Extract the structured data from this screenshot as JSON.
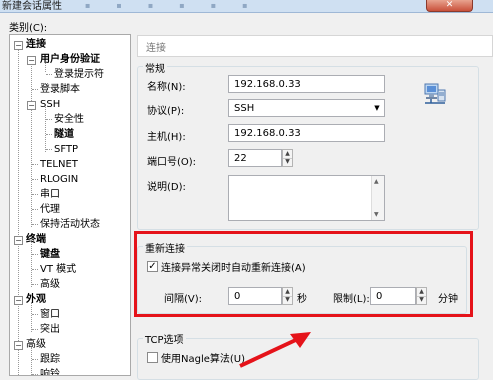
{
  "window": {
    "title": "新建会话属性",
    "close_glyph": "✕"
  },
  "category_label": "类别(C):",
  "tree": {
    "connection": "连接",
    "user_auth": "用户身份验证",
    "login_prompt": "登录提示符",
    "login_script": "登录脚本",
    "ssh": "SSH",
    "security": "安全性",
    "tunnel": "隧道",
    "sftp": "SFTP",
    "telnet": "TELNET",
    "rlogin": "RLOGIN",
    "serial": "串口",
    "proxy": "代理",
    "keepalive": "保持活动状态",
    "terminal": "终端",
    "keyboard": "键盘",
    "vt_mode": "VT 模式",
    "advanced": "高级",
    "appearance": "外观",
    "window": "窗口",
    "highlight": "突出",
    "advanced2": "高级",
    "trace": "跟踪",
    "bell": "响铃"
  },
  "panel_header": "连接",
  "general": {
    "title": "常规",
    "name_label": "名称(N):",
    "name_value": "192.168.0.33",
    "protocol_label": "协议(P):",
    "protocol_value": "SSH",
    "host_label": "主机(H):",
    "host_value": "192.168.0.33",
    "port_label": "端口号(O):",
    "port_value": "22",
    "desc_label": "说明(D):",
    "desc_value": ""
  },
  "reconnect": {
    "title": "重新连接",
    "checkbox_label": "连接异常关闭时自动重新连接(A)",
    "checked": true,
    "interval_label": "间隔(V):",
    "interval_value": "0",
    "interval_unit": "秒",
    "limit_label": "限制(L):",
    "limit_value": "0",
    "limit_unit": "分钟"
  },
  "tcp": {
    "title": "TCP选项",
    "nagle_label": "使用Nagle算法(U)",
    "nagle_checked": false
  },
  "colors": {
    "highlight_box": "#e5131a"
  }
}
